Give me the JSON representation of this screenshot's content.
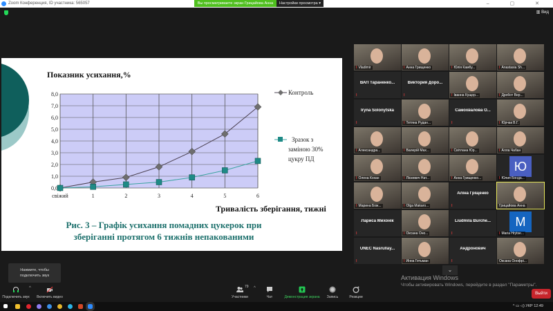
{
  "window": {
    "title": "Zoom Конференция, ID участника: 565057",
    "controls": "–  ▢  ✕"
  },
  "share_banner": {
    "text": "Вы просматриваете экран Грицайова Анна",
    "view_options": "Настройки просмотра ▾"
  },
  "view_button": "Вид",
  "slide": {
    "caption_line1": "Рис. 3 – Графік усихання помадних цукерок при",
    "caption_line2": "зберіганні протягом 6 тижнів непакованими"
  },
  "chart_data": {
    "type": "line",
    "title": "Показник усихання,%",
    "xlabel": "Тривалість зберігання, тижні",
    "ylabel": "Показник усихання,%",
    "categories": [
      "свіжий",
      "1",
      "2",
      "3",
      "4",
      "5",
      "6"
    ],
    "ylim": [
      0,
      8
    ],
    "yticks": [
      "0,0",
      "1,0",
      "2,0",
      "3,0",
      "4,0",
      "5,0",
      "6,0",
      "7,0",
      "8,0"
    ],
    "grid": true,
    "legend_position": "right",
    "series": [
      {
        "name": "Контроль",
        "values": [
          0,
          0.5,
          0.9,
          1.8,
          3.1,
          4.6,
          6.9
        ],
        "color": "#6e6e6e",
        "marker": "diamond"
      },
      {
        "name_lines": [
          "Зразок з",
          "заміною 30%",
          "цукру ПД"
        ],
        "values": [
          0,
          0.1,
          0.3,
          0.5,
          0.9,
          1.5,
          2.3
        ],
        "color": "#1e8a86",
        "marker": "square"
      }
    ]
  },
  "participants": [
    {
      "name": "Vladimir",
      "video": true
    },
    {
      "name": "Анна Грищенко",
      "video": true
    },
    {
      "name": "Юлія Камбу...",
      "video": true
    },
    {
      "name": "Anastasia Sh...",
      "video": true
    },
    {
      "name": "ВАП Тараненко...",
      "video": false
    },
    {
      "name": "Виктория Доро...",
      "video": false
    },
    {
      "name": "Іванна Кущор...",
      "video": true
    },
    {
      "name": "Дробот Вер...",
      "video": true
    },
    {
      "name": "Iryna Solonytska",
      "video": false
    },
    {
      "name": "Тетяна Рудан...",
      "video": true
    },
    {
      "name": "Самохвалова О...",
      "video": false
    },
    {
      "name": "Юрчак В.Г.",
      "video": true
    },
    {
      "name": "Александра...",
      "video": true
    },
    {
      "name": "Валерій Мах...",
      "video": true
    },
    {
      "name": "Світлана Юр...",
      "video": true
    },
    {
      "name": "Алла Чабан",
      "video": true
    },
    {
      "name": "Олена Кохан",
      "video": true
    },
    {
      "name": "Ліскевич Нат...",
      "video": true
    },
    {
      "name": "Анна Грищенко...",
      "video": true
    },
    {
      "name": "Юлия Бонда...",
      "avatar": "Ю",
      "avatar_color": "#4a5fc1"
    },
    {
      "name": "Марина Бож...",
      "video": true
    },
    {
      "name": "Olga Makaro...",
      "video": true
    },
    {
      "name": "Аліна Гріщенко",
      "video": false
    },
    {
      "name": "Грицайова Анна",
      "video": true,
      "active": true,
      "unmuted": true
    },
    {
      "name": "Лариса Михонік",
      "video": false
    },
    {
      "name": "Оксана Оно...",
      "video": true
    },
    {
      "name": "Liudmila Burche...",
      "video": false
    },
    {
      "name": "Maria Hrytse...",
      "avatar": "M",
      "avatar_color": "#1565c0"
    },
    {
      "name": "UNEC Nasrullay...",
      "video": false
    },
    {
      "name": "Инна Гетьман",
      "video": true
    },
    {
      "name": "Андронович",
      "video": false
    },
    {
      "name": "Оксана Онофрі...",
      "video": true,
      "unmuted": true
    }
  ],
  "activation": {
    "title": "Активация Windows",
    "text": "Чтобы активировать Windows, перейдите в раздел \"Параметры\"."
  },
  "tooltip": {
    "line1": "Нажмите, чтобы",
    "line2": "подключить звук"
  },
  "toolbar": {
    "audio": "Подключить звук",
    "video": "Включить видео",
    "participants": "Участники",
    "participants_count": "79",
    "chat": "Чат",
    "share": "Демонстрация экрана",
    "record": "Запись",
    "reactions": "Реакции",
    "leave": "Выйти"
  },
  "taskbar": {
    "tray": "^  ▭  ◁)  УКР  12:49"
  }
}
